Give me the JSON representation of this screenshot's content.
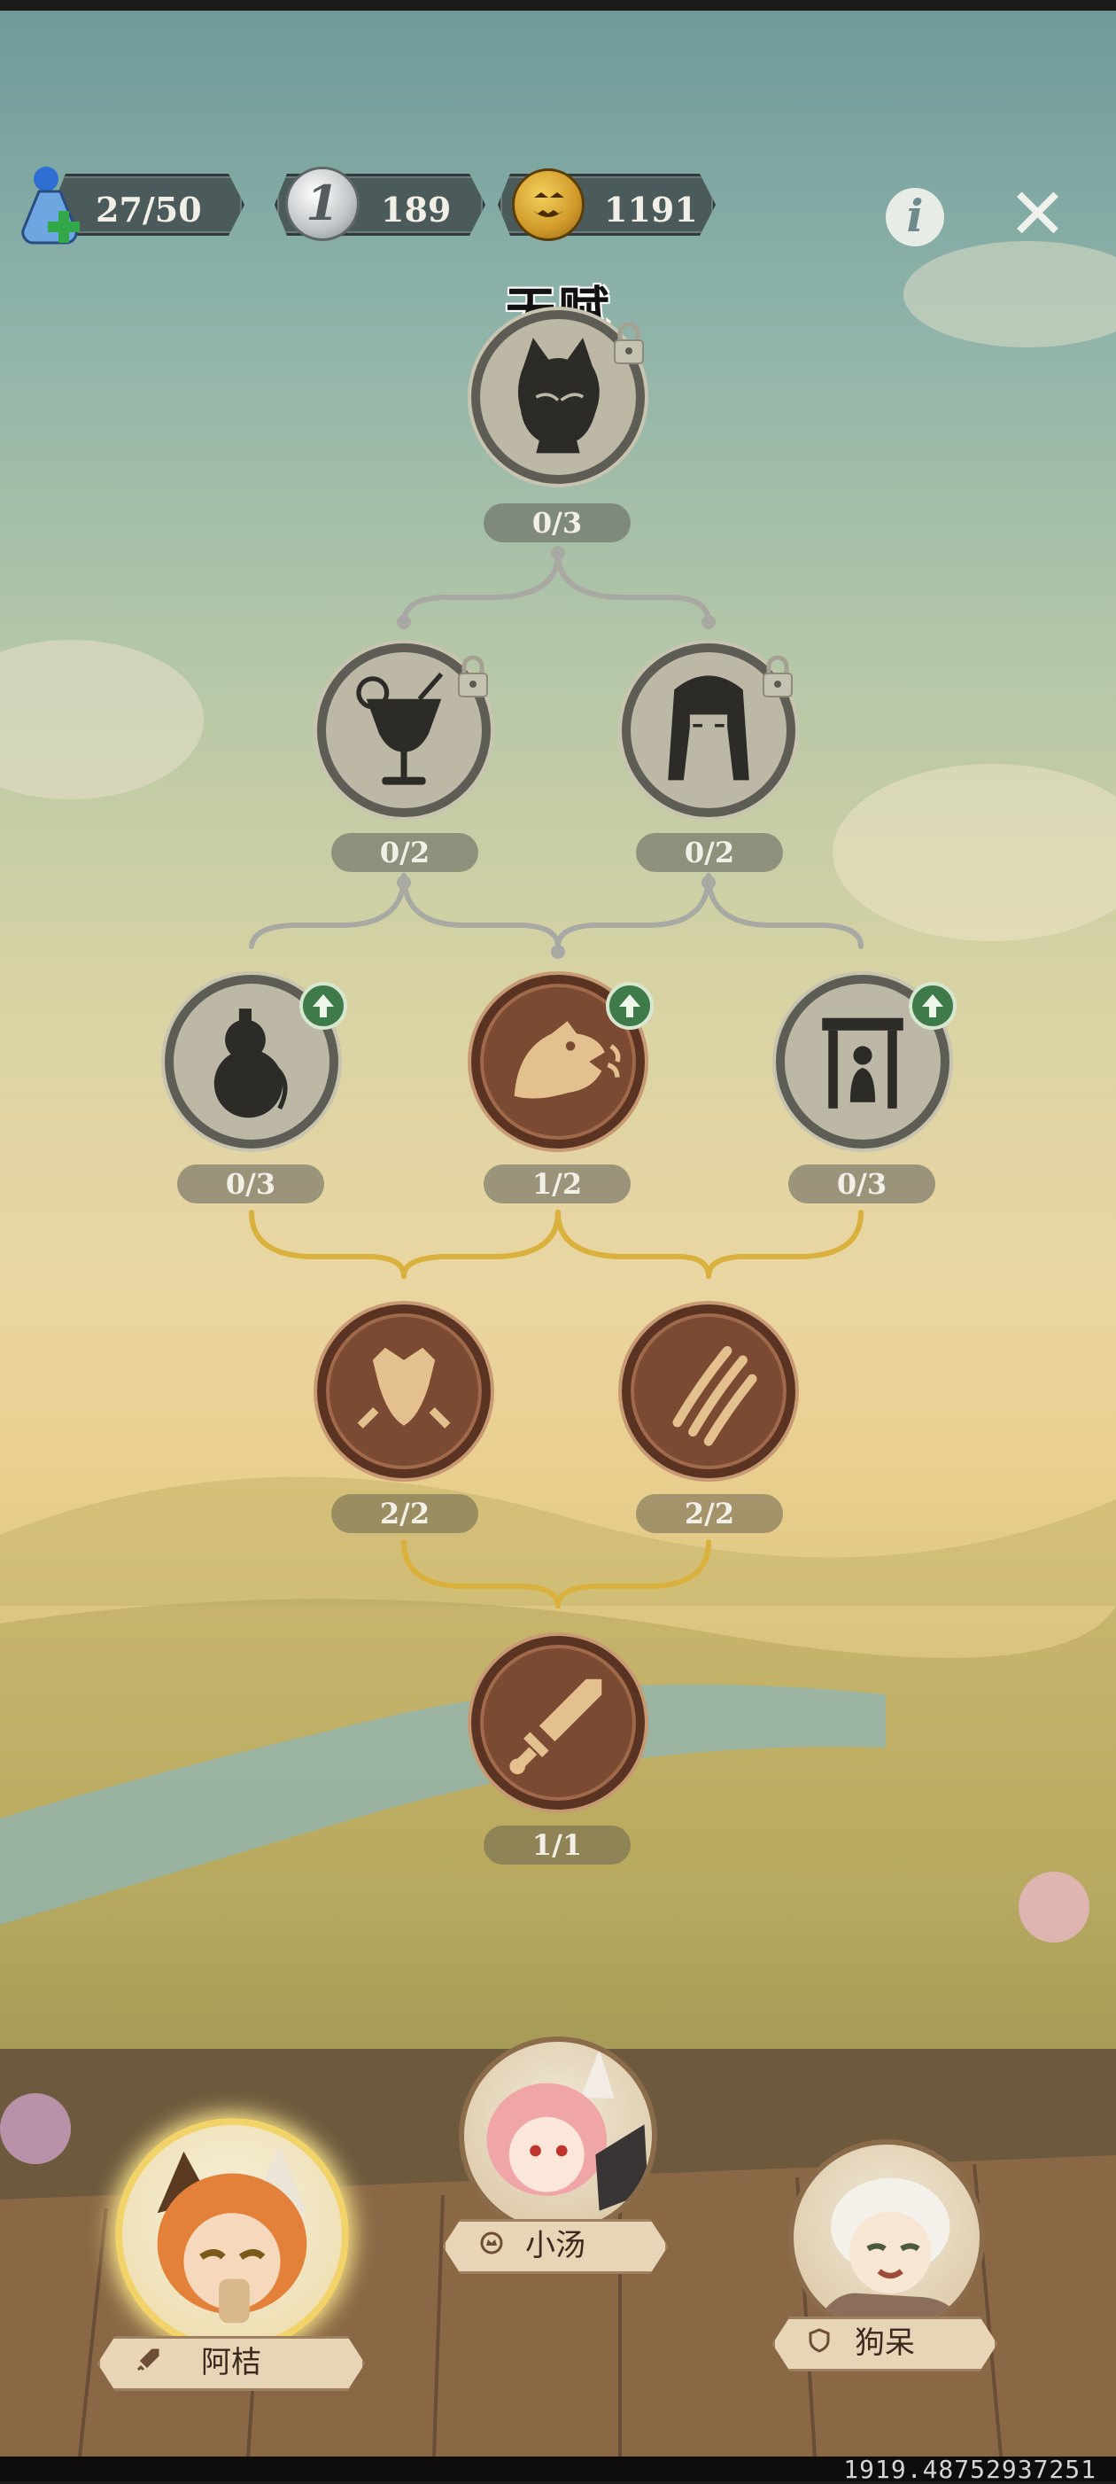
{
  "header": {
    "energy": {
      "icon": "potion-icon",
      "value": "27/50"
    },
    "silver_coin": {
      "icon": "silver-coin-icon",
      "glyph": "1",
      "value": "189"
    },
    "pumpkin_coin": {
      "icon": "pumpkin-coin-icon",
      "value": "1191"
    },
    "info_glyph": "i",
    "close_glyph": "✕"
  },
  "title": "天赋",
  "talents": {
    "tier1": [
      {
        "icon": "cat-girl-silhouette-icon",
        "count": "0/3",
        "state": "locked"
      }
    ],
    "tier2": [
      {
        "icon": "cocktail-icon",
        "count": "0/2",
        "state": "locked"
      },
      {
        "icon": "long-hair-girl-icon",
        "count": "0/2",
        "state": "locked"
      }
    ],
    "tier3": [
      {
        "icon": "gourd-icon",
        "count": "0/3",
        "state": "upgradable"
      },
      {
        "icon": "roaring-beast-icon",
        "count": "1/2",
        "state": "upgradable-active"
      },
      {
        "icon": "doorway-figure-icon",
        "count": "0/3",
        "state": "upgradable"
      }
    ],
    "tier4": [
      {
        "icon": "shield-icon",
        "count": "2/2",
        "state": "active"
      },
      {
        "icon": "claw-marks-icon",
        "count": "2/2",
        "state": "active"
      }
    ],
    "tier5": [
      {
        "icon": "sword-icon",
        "count": "1/1",
        "state": "active"
      }
    ]
  },
  "characters": [
    {
      "name": "阿桔",
      "role_icon": "sword-icon",
      "selected": true
    },
    {
      "name": "小汤",
      "role_icon": "crown-icon",
      "selected": false
    },
    {
      "name": "狗呆",
      "role_icon": "shield-icon",
      "selected": false
    }
  ],
  "colors": {
    "locked_node": "#bdb7a5",
    "active_node": "#7a4a33",
    "gold_connector": "#d9b13c",
    "gray_connector": "#a9a9a4",
    "upgrade_badge": "#3f7a4a"
  },
  "footer_text": "1919.48752937251"
}
